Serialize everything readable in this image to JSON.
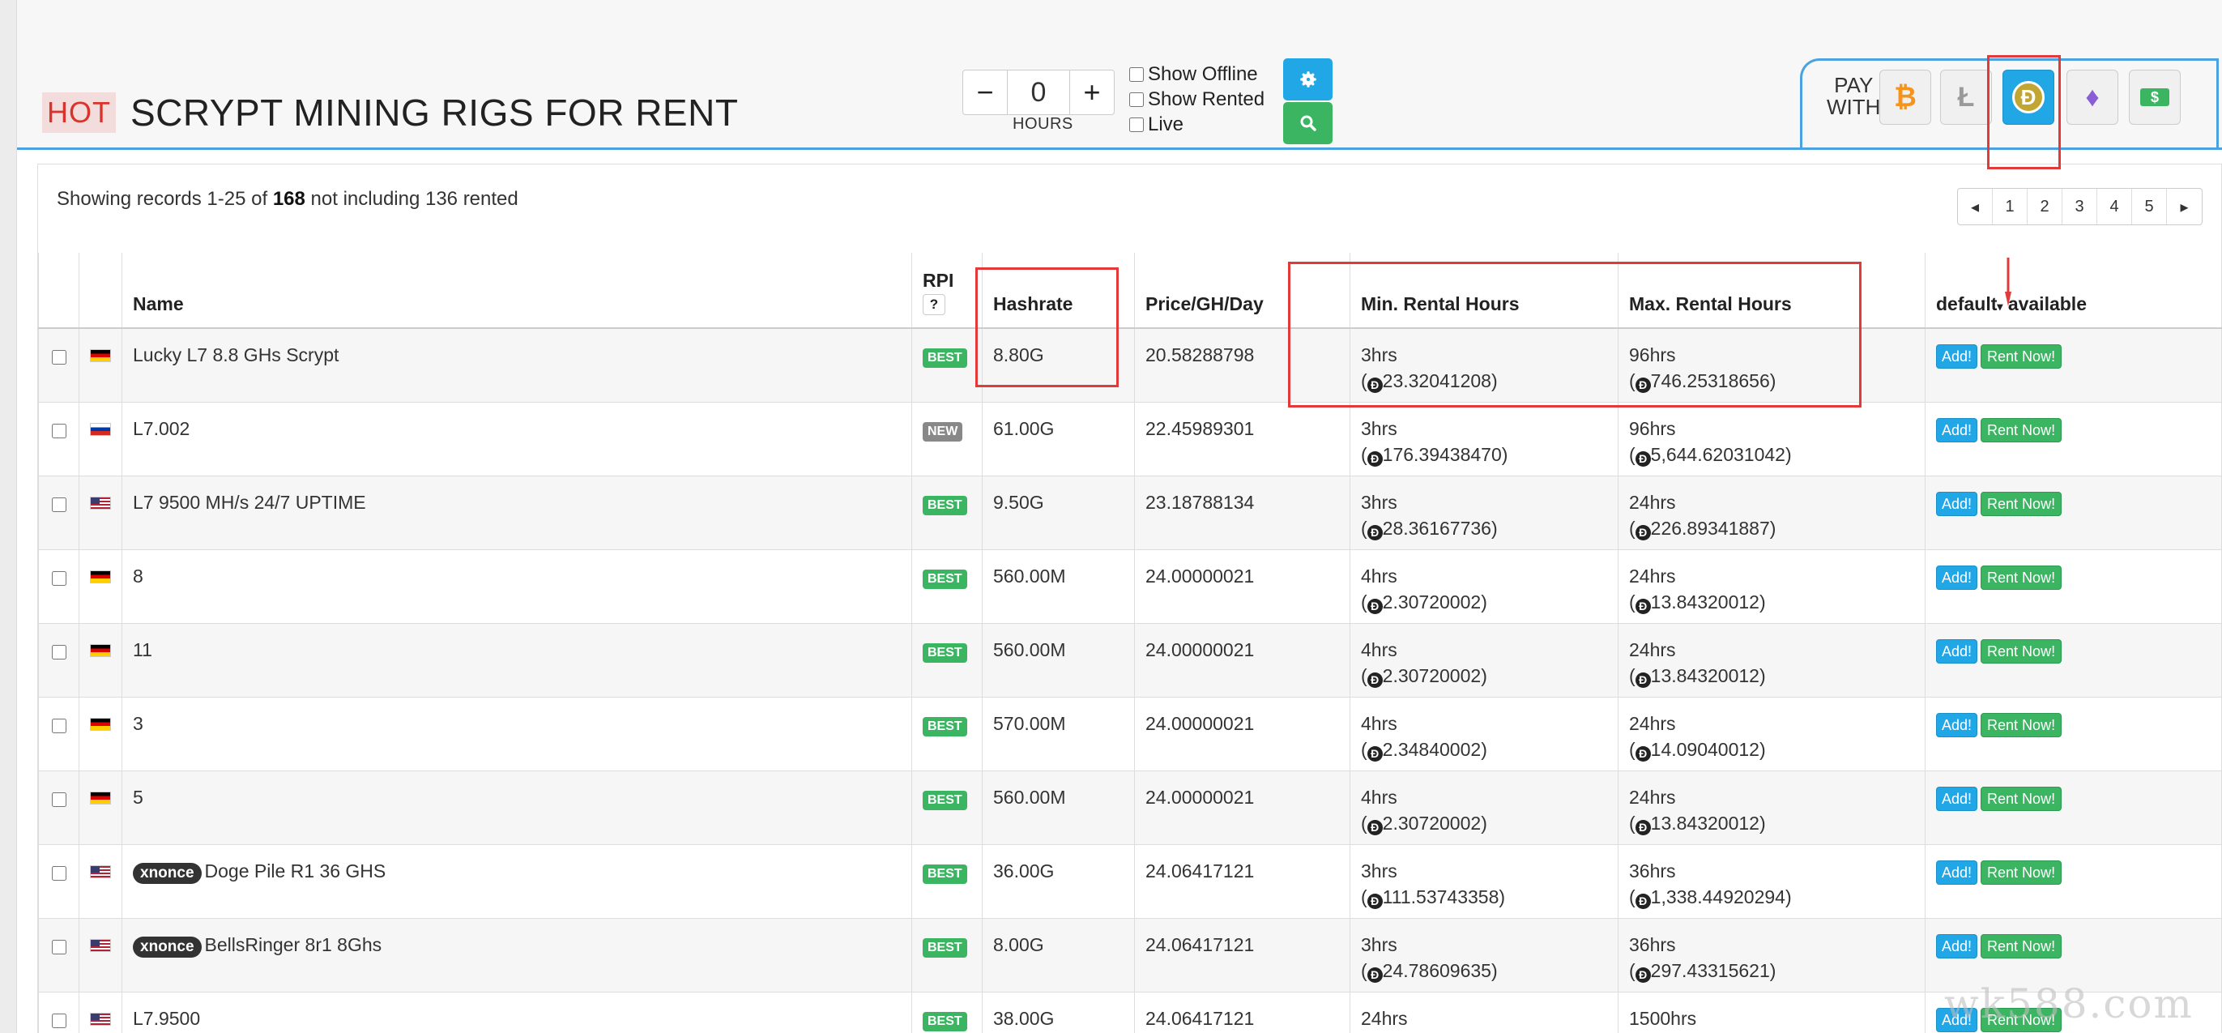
{
  "header": {
    "hot_label": "HOT",
    "title": "SCRYPT MINING RIGS FOR RENT"
  },
  "hours": {
    "minus": "−",
    "value": "0",
    "plus": "+",
    "label": "HOURS"
  },
  "filters": {
    "show_offline": "Show Offline",
    "show_rented": "Show Rented",
    "live": "Live"
  },
  "buttons": {
    "settings_icon": "gear-icon",
    "search_icon": "search-icon"
  },
  "pay": {
    "label_line1": "PAY",
    "label_line2": "WITH",
    "coins": [
      {
        "name": "bitcoin",
        "glyph": "₿",
        "color": "#f7931a"
      },
      {
        "name": "litecoin",
        "glyph": "Ł",
        "color": "#9a9a9a"
      },
      {
        "name": "dogecoin",
        "glyph": "Ð",
        "color": "#c2a633",
        "active": true
      },
      {
        "name": "ethereum",
        "glyph": "♦",
        "color": "#8a5cd6"
      },
      {
        "name": "cash",
        "glyph": "$",
        "color": "#3cb563"
      }
    ]
  },
  "records": {
    "prefix": "Showing records 1-25 of",
    "total": "168",
    "suffix": "not including 136 rented"
  },
  "pagination": [
    "◂",
    "1",
    "2",
    "3",
    "4",
    "5",
    "▸"
  ],
  "table": {
    "headers": {
      "name": "Name",
      "rpi": "RPI",
      "rpi_help": "?",
      "hashrate": "Hashrate",
      "price": "Price/GH/Day",
      "min_hours": "Min. Rental Hours",
      "max_hours": "Max. Rental Hours",
      "status": "default",
      "status2": "available"
    },
    "add_label": "Add!",
    "rent_label": "Rent Now!",
    "rows": [
      {
        "flag": "de",
        "tag": "",
        "name": "Lucky L7 8.8 GHs Scrypt",
        "rpi": "BEST",
        "hashrate": "8.80G",
        "price": "20.58288798",
        "min": "3hrs",
        "min_cost": "23.32041208",
        "max": "96hrs",
        "max_cost": "746.25318656"
      },
      {
        "flag": "ru",
        "tag": "",
        "name": "L7.002",
        "rpi": "NEW",
        "hashrate": "61.00G",
        "price": "22.45989301",
        "min": "3hrs",
        "min_cost": "176.39438470",
        "max": "96hrs",
        "max_cost": "5,644.62031042"
      },
      {
        "flag": "us",
        "tag": "",
        "name": "L7 9500 MH/s 24/7 UPTIME",
        "rpi": "BEST",
        "hashrate": "9.50G",
        "price": "23.18788134",
        "min": "3hrs",
        "min_cost": "28.36167736",
        "max": "24hrs",
        "max_cost": "226.89341887"
      },
      {
        "flag": "de",
        "tag": "",
        "name": "8",
        "rpi": "BEST",
        "hashrate": "560.00M",
        "price": "24.00000021",
        "min": "4hrs",
        "min_cost": "2.30720002",
        "max": "24hrs",
        "max_cost": "13.84320012"
      },
      {
        "flag": "de",
        "tag": "",
        "name": "11",
        "rpi": "BEST",
        "hashrate": "560.00M",
        "price": "24.00000021",
        "min": "4hrs",
        "min_cost": "2.30720002",
        "max": "24hrs",
        "max_cost": "13.84320012"
      },
      {
        "flag": "de",
        "tag": "",
        "name": "3",
        "rpi": "BEST",
        "hashrate": "570.00M",
        "price": "24.00000021",
        "min": "4hrs",
        "min_cost": "2.34840002",
        "max": "24hrs",
        "max_cost": "14.09040012"
      },
      {
        "flag": "de",
        "tag": "",
        "name": "5",
        "rpi": "BEST",
        "hashrate": "560.00M",
        "price": "24.00000021",
        "min": "4hrs",
        "min_cost": "2.30720002",
        "max": "24hrs",
        "max_cost": "13.84320012"
      },
      {
        "flag": "us",
        "tag": "xnonce",
        "name": "Doge Pile R1 36 GHS",
        "rpi": "BEST",
        "hashrate": "36.00G",
        "price": "24.06417121",
        "min": "3hrs",
        "min_cost": "111.53743358",
        "max": "36hrs",
        "max_cost": "1,338.44920294"
      },
      {
        "flag": "us",
        "tag": "xnonce",
        "name": "BellsRinger 8r1 8Ghs",
        "rpi": "BEST",
        "hashrate": "8.00G",
        "price": "24.06417121",
        "min": "3hrs",
        "min_cost": "24.78609635",
        "max": "36hrs",
        "max_cost": "297.43315621"
      },
      {
        "flag": "us",
        "tag": "",
        "name": "L7.9500",
        "rpi": "BEST",
        "hashrate": "38.00G",
        "price": "24.06417121",
        "min": "24hrs",
        "min_cost": "",
        "max": "1500hrs",
        "max_cost": ""
      }
    ]
  },
  "watermark": "wk588.com"
}
